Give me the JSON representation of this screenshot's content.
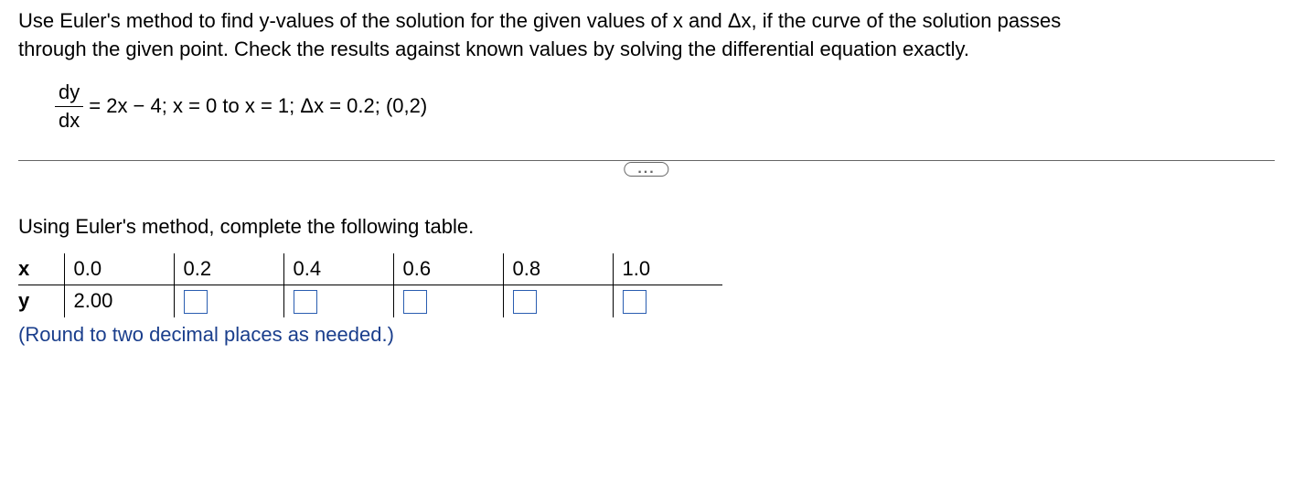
{
  "problem": {
    "line1": "Use Euler's method to find y-values of the solution for the given values of x and Δx, if the curve of the solution passes",
    "line2": "through the given point. Check the results against known values by solving the differential equation exactly.",
    "eq_frac_num": "dy",
    "eq_frac_den": "dx",
    "eq_right": " = 2x − 4; x = 0 to x = 1; Δx = 0.2; (0,2)"
  },
  "divider": {
    "ellipsis": "..."
  },
  "instruction": "Using Euler's method, complete the following table.",
  "table": {
    "row_x_label": "x",
    "row_y_label": "y",
    "x": [
      "0.0",
      "0.2",
      "0.4",
      "0.6",
      "0.8",
      "1.0"
    ],
    "y0": "2.00"
  },
  "hint": "(Round to two decimal places as needed.)",
  "chart_data": {
    "type": "table",
    "columns": [
      "x",
      "y"
    ],
    "rows": [
      {
        "x": 0.0,
        "y": 2.0
      },
      {
        "x": 0.2,
        "y": null
      },
      {
        "x": 0.4,
        "y": null
      },
      {
        "x": 0.6,
        "y": null
      },
      {
        "x": 0.8,
        "y": null
      },
      {
        "x": 1.0,
        "y": null
      }
    ],
    "note": "y values for x>0 are blank input fields to be filled by student"
  }
}
